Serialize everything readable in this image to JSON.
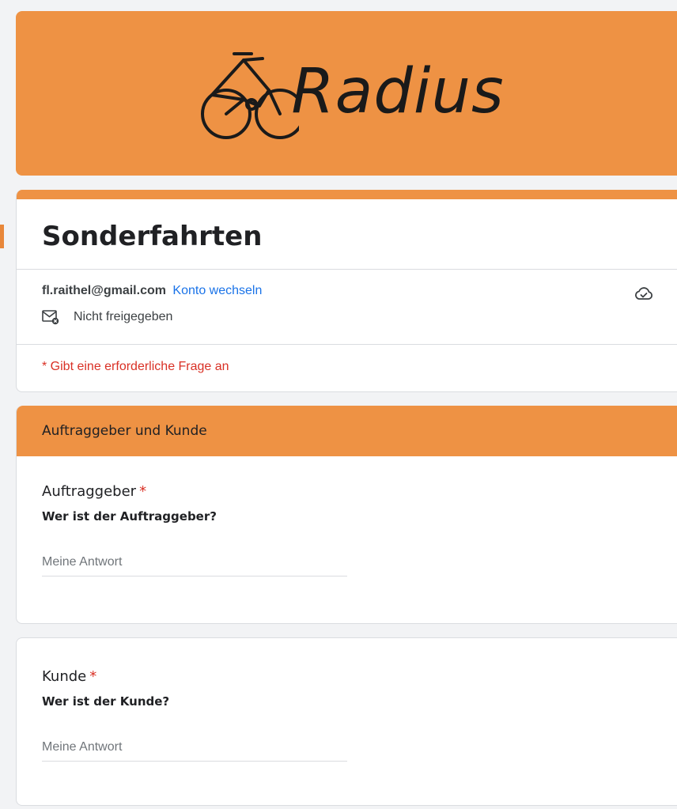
{
  "banner": {
    "brand": "Radius",
    "background": "#ee9244",
    "logo_icon": "bicycle-icon"
  },
  "form": {
    "title": "Sonderfahrten",
    "accent_color": "#ee9244"
  },
  "account": {
    "email": "fl.raithel@gmail.com",
    "switch_label": "Konto wechseln",
    "not_shared_label": "Nicht freigegeben",
    "not_shared_icon": "mail-blocked-icon",
    "sync_icon": "cloud-check-icon"
  },
  "required_note": "* Gibt eine erforderliche Frage an",
  "section": {
    "title": "Auftraggeber und Kunde"
  },
  "questions": [
    {
      "title": "Auftraggeber",
      "required_mark": "*",
      "description": "Wer ist der Auftraggeber?",
      "placeholder": "Meine Antwort"
    },
    {
      "title": "Kunde",
      "required_mark": "*",
      "description": "Wer ist der Kunde?",
      "placeholder": "Meine Antwort"
    }
  ]
}
